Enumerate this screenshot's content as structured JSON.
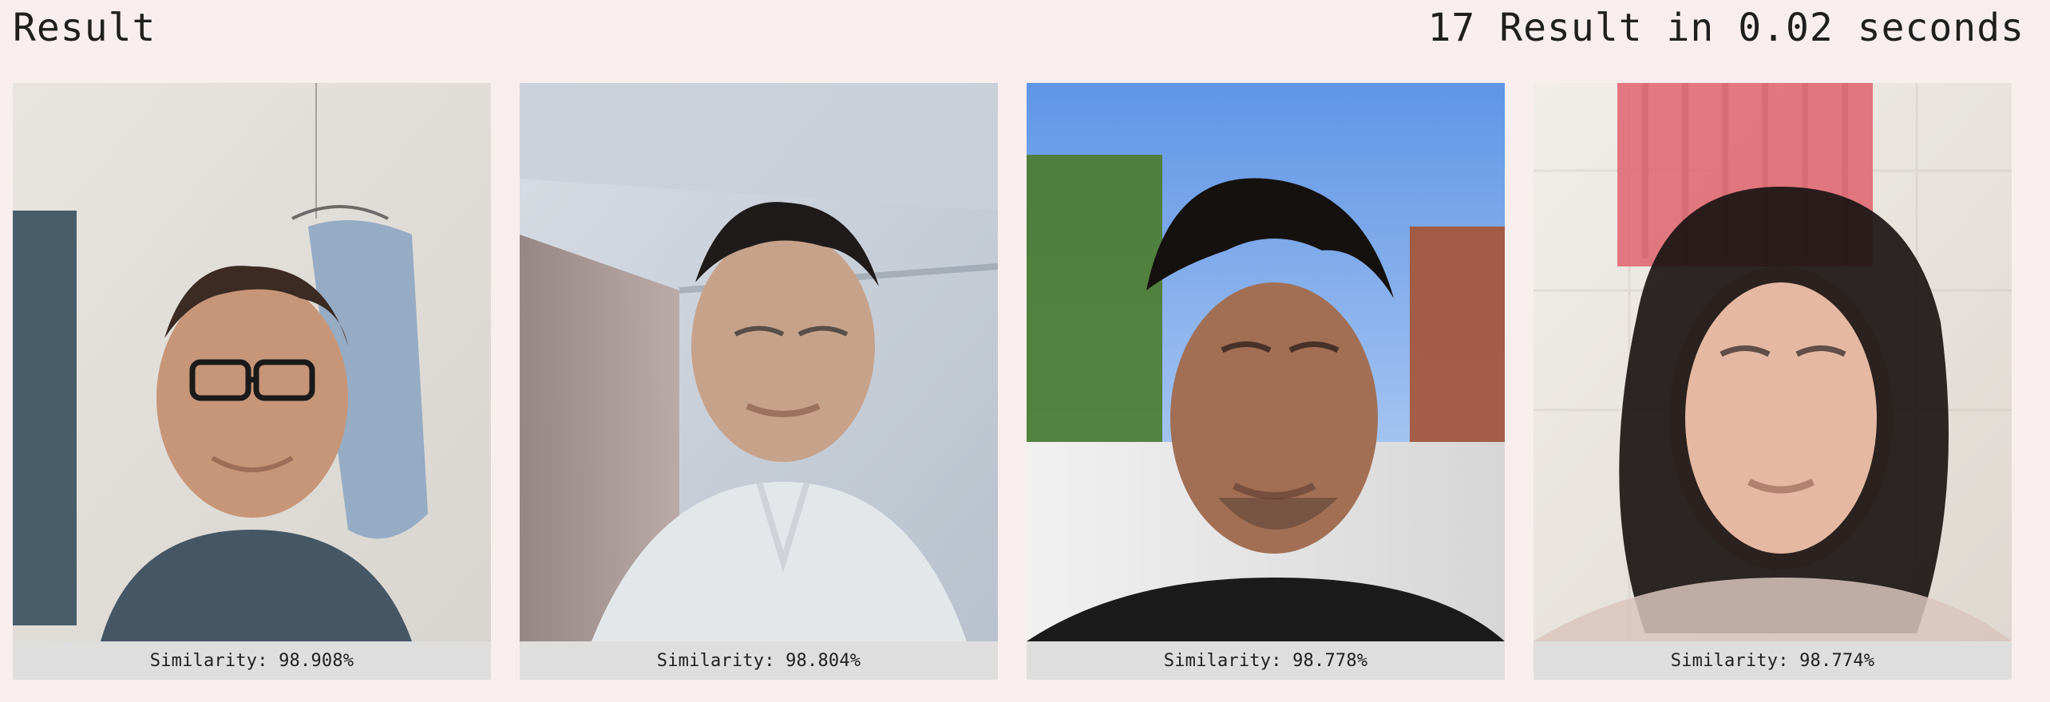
{
  "header": {
    "title": "Result",
    "meta": "17 Result in 0.02 seconds"
  },
  "results": [
    {
      "image": "face-photo-1",
      "similarity_label": "Similarity:",
      "similarity_value": "98.908%"
    },
    {
      "image": "face-photo-2",
      "similarity_label": "Similarity:",
      "similarity_value": "98.804%"
    },
    {
      "image": "face-photo-3",
      "similarity_label": "Similarity:",
      "similarity_value": "98.778%"
    },
    {
      "image": "face-photo-4",
      "similarity_label": "Similarity:",
      "similarity_value": "98.774%"
    }
  ],
  "theme": {
    "background": "#f7eeed",
    "caption_bg": "#dedede",
    "text": "#1f1f1f"
  }
}
